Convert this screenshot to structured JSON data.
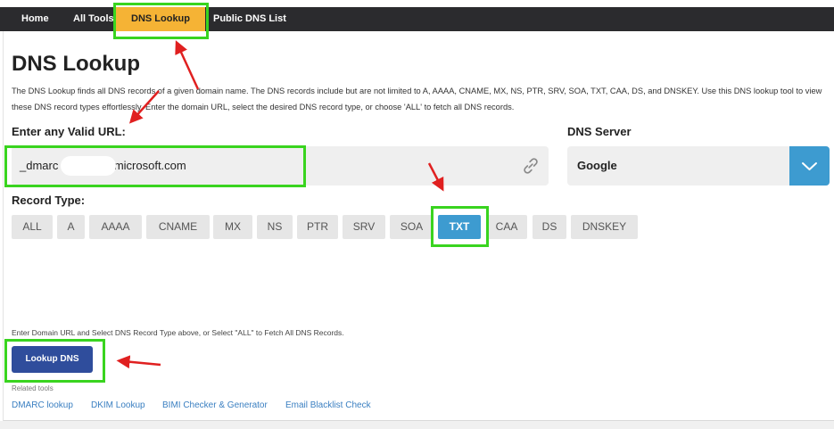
{
  "nav": {
    "items": [
      {
        "label": "Home"
      },
      {
        "label": "All Tools"
      },
      {
        "label": "DNS Lookup"
      },
      {
        "label": "Public DNS List"
      }
    ]
  },
  "page": {
    "title": "DNS Lookup",
    "description": "The DNS Lookup finds all DNS records of a given domain name. The DNS records include but are not limited to A, AAAA, CNAME, MX, NS, PTR, SRV, SOA, TXT, CAA, DS, and DNSKEY. Use this DNS lookup tool to view these DNS record types effortlessly. Enter the domain URL, select the desired DNS record type, or choose 'ALL' to fetch all DNS records."
  },
  "url_field": {
    "label": "Enter any Valid URL:",
    "value_prefix": "_dmarc",
    "value_suffix": "onmicrosoft.com"
  },
  "dns_server": {
    "label": "DNS Server",
    "value": "Google"
  },
  "record_type": {
    "label": "Record Type:",
    "options": [
      "ALL",
      "A",
      "AAAA",
      "CNAME",
      "MX",
      "NS",
      "PTR",
      "SRV",
      "SOA",
      "TXT",
      "CAA",
      "DS",
      "DNSKEY"
    ],
    "selected": "TXT"
  },
  "hint": "Enter Domain URL and Select DNS Record Type above, or Select \"ALL\" to Fetch All DNS Records.",
  "lookup_button": "Lookup DNS",
  "related": {
    "label": "Related tools",
    "links": [
      "DMARC lookup",
      "DKIM Lookup",
      "BIMI Checker & Generator",
      "Email Blacklist Check"
    ]
  },
  "colors": {
    "nav_bg": "#2b2b2e",
    "nav_active": "#f5b335",
    "accent_blue": "#3d9bd0",
    "button_blue": "#2f4d9c",
    "highlight_green": "#39d41f",
    "annotation_red": "#e02020",
    "link_blue": "#3a7fc1"
  },
  "icons": {
    "url_icon": "link-icon",
    "server_dropdown": "chevron-down-icon"
  }
}
